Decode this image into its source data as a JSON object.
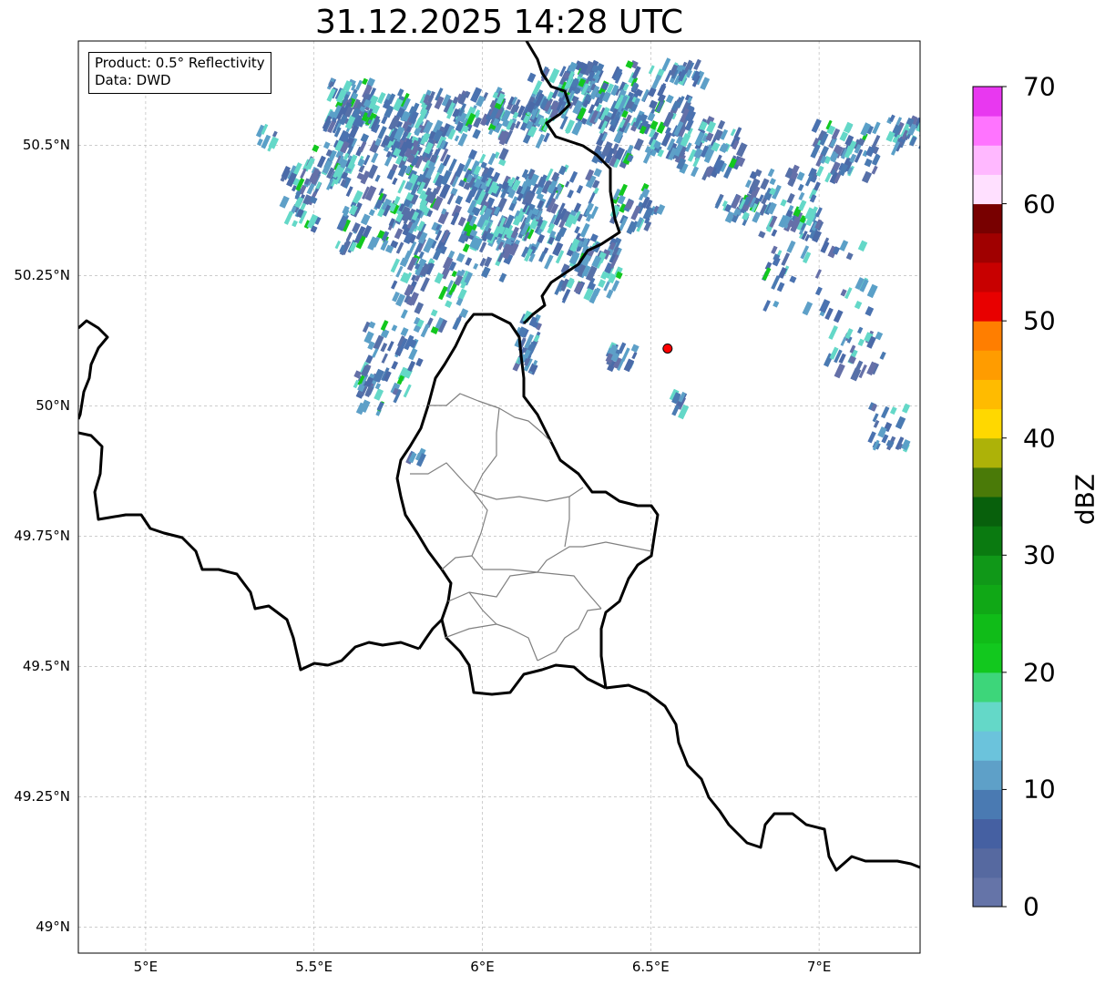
{
  "title": "31.12.2025 14:28 UTC",
  "info": {
    "line1": "Product: 0.5° Reflectivity",
    "line2": "Data: DWD"
  },
  "map": {
    "extent": {
      "lon_min": 4.8,
      "lon_max": 7.3,
      "lat_min": 48.95,
      "lat_max": 50.7
    },
    "lat_ticks": [
      {
        "value": 50.5,
        "label": "50.5°N"
      },
      {
        "value": 50.25,
        "label": "50.25°N"
      },
      {
        "value": 50.0,
        "label": "50°N"
      },
      {
        "value": 49.75,
        "label": "49.75°N"
      },
      {
        "value": 49.5,
        "label": "49.5°N"
      },
      {
        "value": 49.25,
        "label": "49.25°N"
      },
      {
        "value": 49.0,
        "label": "49°N"
      }
    ],
    "lon_ticks": [
      {
        "value": 5.0,
        "label": "5°E"
      },
      {
        "value": 5.5,
        "label": "5.5°E"
      },
      {
        "value": 6.0,
        "label": "6°E"
      },
      {
        "value": 6.5,
        "label": "6.5°E"
      },
      {
        "value": 7.0,
        "label": "7°E"
      }
    ],
    "radar_site": {
      "lon": 6.55,
      "lat": 50.11,
      "color": "#ff0000"
    },
    "colors": {
      "border": "#000000",
      "admin": "#808080",
      "grid": "#b0b0b0"
    }
  },
  "colorbar": {
    "label": "dBZ",
    "min": 0,
    "max": 70,
    "ticks": [
      {
        "value": 0,
        "label": "0"
      },
      {
        "value": 10,
        "label": "10"
      },
      {
        "value": 20,
        "label": "20"
      },
      {
        "value": 30,
        "label": "30"
      },
      {
        "value": 40,
        "label": "40"
      },
      {
        "value": 50,
        "label": "50"
      },
      {
        "value": 60,
        "label": "60"
      },
      {
        "value": 70,
        "label": "70"
      }
    ],
    "colors": [
      "#6574a8",
      "#5669a0",
      "#4560a2",
      "#4a7ab2",
      "#5ea0c8",
      "#6bc3dc",
      "#64d8c8",
      "#3dd67a",
      "#12c81e",
      "#10bc18",
      "#10a816",
      "#109818",
      "#0a7a10",
      "#08600c",
      "#4a7a08",
      "#adb208",
      "#ffd800",
      "#ffbb00",
      "#ff9c00",
      "#ff7e00",
      "#e80000",
      "#c80000",
      "#a00000",
      "#780000",
      "#ffe0ff",
      "#ffb8ff",
      "#ff74ff",
      "#e838f0"
    ]
  }
}
